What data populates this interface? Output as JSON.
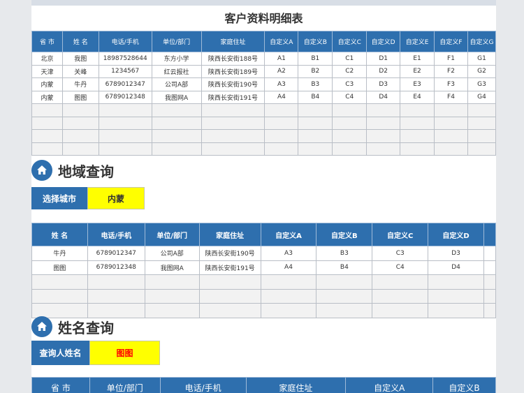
{
  "title": "客户资料明细表",
  "main_table": {
    "headers": [
      "省 市",
      "姓 名",
      "电话/手机",
      "单位/部门",
      "家庭住址",
      "自定义A",
      "自定义B",
      "自定义C",
      "自定义D",
      "自定义E",
      "自定义F",
      "自定义G"
    ],
    "rows": [
      [
        "北京",
        "我图",
        "18987528644",
        "东方小学",
        "陕西长安街188号",
        "A1",
        "B1",
        "C1",
        "D1",
        "E1",
        "F1",
        "G1"
      ],
      [
        "天津",
        "关峰",
        "1234567",
        "红云报社",
        "陕西长安街189号",
        "A2",
        "B2",
        "C2",
        "D2",
        "E2",
        "F2",
        "G2"
      ],
      [
        "内蒙",
        "牛丹",
        "6789012347",
        "公司A部",
        "陕西长安街190号",
        "A3",
        "B3",
        "C3",
        "D3",
        "E3",
        "F3",
        "G3"
      ],
      [
        "内蒙",
        "图图",
        "6789012348",
        "我图网A",
        "陕西长安街191号",
        "A4",
        "B4",
        "C4",
        "D4",
        "E4",
        "F4",
        "G4"
      ]
    ]
  },
  "region_query": {
    "heading": "地域查询",
    "label": "选择城市",
    "value": "内蒙",
    "headers": [
      "姓 名",
      "电话/手机",
      "单位/部门",
      "家庭住址",
      "自定义A",
      "自定义B",
      "自定义C",
      "自定义D"
    ],
    "rows": [
      [
        "牛丹",
        "6789012347",
        "公司A部",
        "陕西长安街190号",
        "A3",
        "B3",
        "C3",
        "D3"
      ],
      [
        "图图",
        "6789012348",
        "我图网A",
        "陕西长安街191号",
        "A4",
        "B4",
        "C4",
        "D4"
      ]
    ]
  },
  "name_query": {
    "heading": "姓名查询",
    "label": "查询人姓名",
    "value": "图图",
    "value_color": "#ff0000",
    "headers": [
      "省 市",
      "单位/部门",
      "电话/手机",
      "家庭住址",
      "自定义A",
      "自定义B"
    ]
  },
  "colors": {
    "header_blue": "#2e6fae",
    "highlight_yellow": "#ffff00"
  },
  "icons": {
    "section": "home-icon"
  }
}
